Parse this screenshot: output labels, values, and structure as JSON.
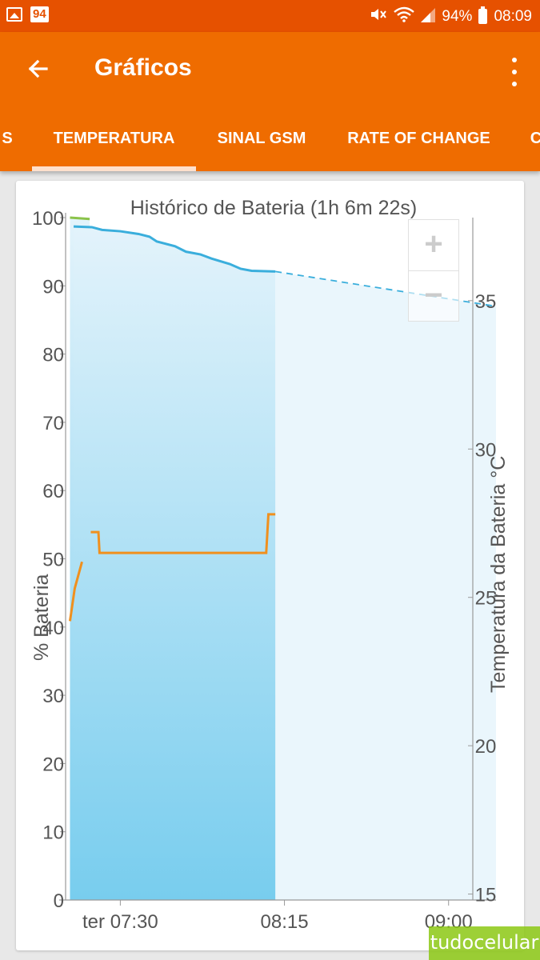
{
  "status_bar": {
    "notification_badge": "94",
    "battery_percent": "94%",
    "time": "08:09",
    "icons": [
      "image-icon",
      "mute-icon",
      "wifi-icon",
      "signal-icon",
      "battery-icon"
    ]
  },
  "app_bar": {
    "title": "Gráficos",
    "tabs": [
      {
        "label": "S",
        "active": false
      },
      {
        "label": "TEMPERATURA",
        "active": true
      },
      {
        "label": "SINAL GSM",
        "active": false
      },
      {
        "label": "RATE OF CHANGE",
        "active": false
      },
      {
        "label": "C",
        "active": false
      }
    ]
  },
  "zoom": {
    "plus": "+",
    "minus": "−"
  },
  "watermark": "tudocelular",
  "colors": {
    "status_bar": "#e65100",
    "app_bar": "#ef6c00",
    "battery_line": "#3aaedc",
    "temperature_line": "#f0901e",
    "charging_line": "#8bc34a"
  },
  "chart_data": {
    "type": "line",
    "title": "Histórico de Bateria (1h 6m 22s)",
    "ylabel": "% Bateria",
    "y2label": "Temperatura da Bateria °C",
    "ylim": [
      0,
      100
    ],
    "y2lim": [
      14.8,
      37.8
    ],
    "yticks": [
      "0",
      "10",
      "20",
      "30",
      "40",
      "50",
      "60",
      "70",
      "80",
      "90",
      "100"
    ],
    "y2ticks": [
      "15",
      "20",
      "25",
      "30",
      "35"
    ],
    "xticks": [
      {
        "label": "ter 07:30",
        "t": 30
      },
      {
        "label": "08:15",
        "t": 75
      },
      {
        "label": "09:00",
        "t": 120
      }
    ],
    "xlim": [
      15,
      133
    ],
    "series": [
      {
        "role": "battery",
        "points": [
          [
            17.2,
            98.7
          ],
          [
            22.2,
            98.6
          ],
          [
            25,
            98.2
          ],
          [
            30,
            98.0
          ],
          [
            35,
            97.6
          ],
          [
            38,
            97.2
          ],
          [
            40,
            96.5
          ],
          [
            45,
            95.8
          ],
          [
            48,
            95.0
          ],
          [
            52,
            94.6
          ],
          [
            55,
            94.0
          ],
          [
            60,
            93.2
          ],
          [
            63,
            92.5
          ],
          [
            66,
            92.2
          ],
          [
            72.5,
            92.1
          ]
        ],
        "projection": [
          [
            72.5,
            92.1
          ],
          [
            133,
            87.0
          ]
        ],
        "charging_segment": [
          [
            16.2,
            100
          ],
          [
            21.6,
            99.8
          ]
        ]
      },
      {
        "role": "temperature",
        "segments": [
          [
            [
              16.2,
              24.2
            ],
            [
              17.5,
              25.3
            ],
            [
              19.5,
              26.2
            ]
          ],
          [
            [
              21.9,
              27.2
            ],
            [
              24,
              27.2
            ],
            [
              24.3,
              26.5
            ],
            [
              70,
              26.5
            ],
            [
              70.6,
              27.8
            ],
            [
              72.5,
              27.8
            ]
          ]
        ]
      }
    ]
  }
}
